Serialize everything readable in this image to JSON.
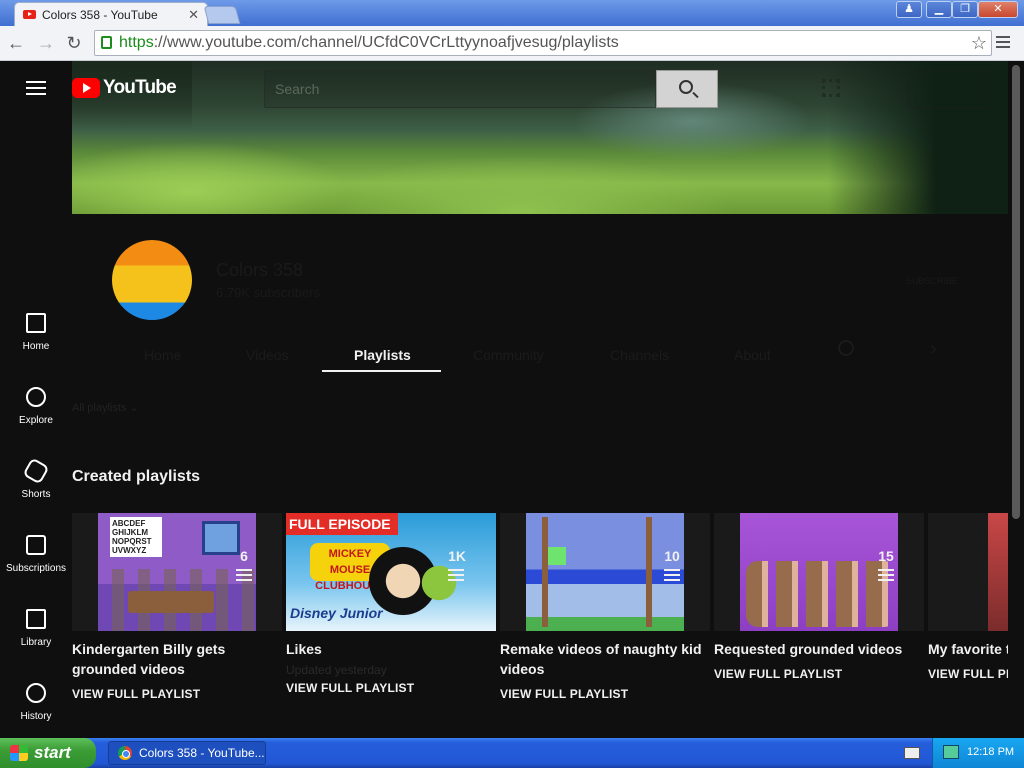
{
  "browser": {
    "tab_title": "Colors 358 - YouTube",
    "tab_close": "✕",
    "url_scheme": "https",
    "url_rest": "://www.youtube.com/channel/UCfdC0VCrLttyynoafjvesug/playlists"
  },
  "window_buttons": {
    "profile": "♟",
    "minimize": "▁",
    "restore": "❐",
    "close": "✕"
  },
  "nav": {
    "back": "←",
    "forward": "→",
    "reload": "↻",
    "star": "☆"
  },
  "youtube": {
    "logo_text": "YouTube",
    "search_placeholder": "Search"
  },
  "sidebar": {
    "items": [
      {
        "label": "Home",
        "icon": "home-icon"
      },
      {
        "label": "Explore",
        "icon": "explore-icon"
      },
      {
        "label": "Shorts",
        "icon": "shorts-icon"
      },
      {
        "label": "Subscriptions",
        "icon": "subscriptions-icon"
      },
      {
        "label": "Library",
        "icon": "library-icon"
      },
      {
        "label": "History",
        "icon": "history-icon"
      }
    ]
  },
  "channel": {
    "name": "Colors 358",
    "subscribers": "6.79K subscribers",
    "subscribe_label": "SUBSCRIBE",
    "tabs": [
      "Home",
      "Videos",
      "Playlists",
      "Community",
      "Channels",
      "About"
    ],
    "active_tab": "Playlists"
  },
  "sort": {
    "label": "All playlists"
  },
  "section": {
    "title": "Created playlists"
  },
  "playlists": [
    {
      "title": "Kindergarten Billy gets grounded videos",
      "count": "6",
      "meta": "",
      "link": "VIEW FULL PLAYLIST",
      "thumb_text": "ABCDEF GHIJKLM NOPQRST UVWXYZ"
    },
    {
      "title": "Likes",
      "count": "1K",
      "meta": "Updated yesterday",
      "link": "VIEW FULL PLAYLIST",
      "thumb_text": "FULL EPISODE",
      "thumb_sub": "MICKEY MOUSE CLUBHOUSE",
      "thumb_brand": "Disney Junior"
    },
    {
      "title": "Remake videos of naughty kid videos",
      "count": "10",
      "meta": "",
      "link": "VIEW FULL PLAYLIST"
    },
    {
      "title": "Requested grounded videos",
      "count": "15",
      "meta": "",
      "link": "VIEW FULL PLAYLIST"
    },
    {
      "title": "My favorite t",
      "count": "",
      "meta": "",
      "link": "VIEW FULL PL"
    }
  ],
  "taskbar": {
    "start_label": "start",
    "task_label": "Colors 358 - YouTube...",
    "clock": "12:18 PM"
  }
}
